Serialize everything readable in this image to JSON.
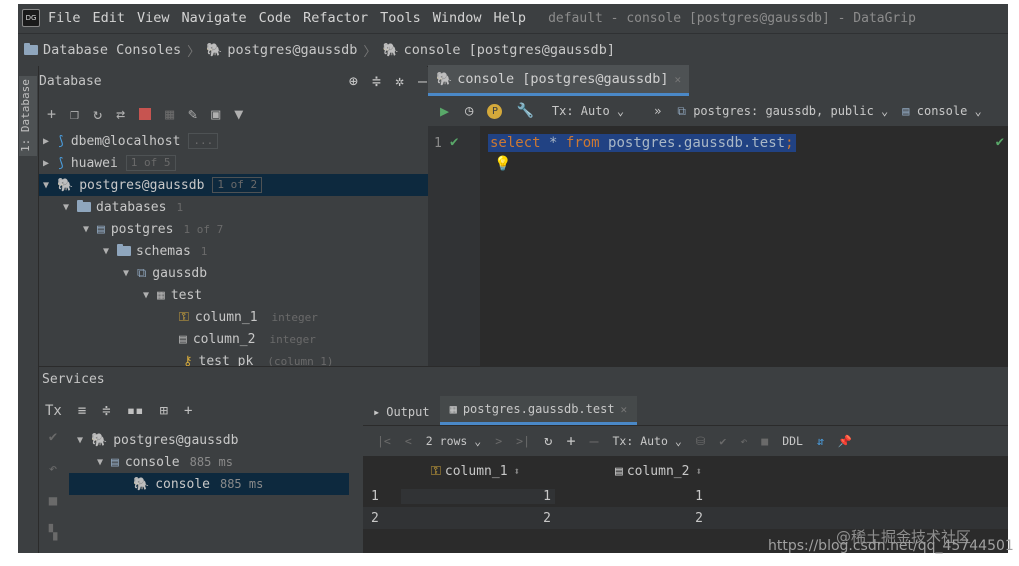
{
  "app": {
    "logo": "DG",
    "menu": [
      "File",
      "Edit",
      "View",
      "Navigate",
      "Code",
      "Refactor",
      "Tools",
      "Window",
      "Help"
    ],
    "window_title": "default - console [postgres@gaussdb] - DataGrip"
  },
  "breadcrumb": [
    "Database Consoles",
    "postgres@gaussdb",
    "console [postgres@gaussdb]"
  ],
  "side_strip": {
    "label": "1: Database"
  },
  "database_panel": {
    "title": "Database",
    "tree": [
      {
        "label": "dbem@localhost",
        "badge": "..."
      },
      {
        "label": "huawei",
        "badge": "1 of 5"
      },
      {
        "label": "postgres@gaussdb",
        "badge": "1 of 2"
      },
      {
        "label": "databases",
        "badge": "1"
      },
      {
        "label": "postgres",
        "badge": "1 of 7"
      },
      {
        "label": "schemas",
        "badge": "1"
      },
      {
        "label": "gaussdb",
        "badge": ""
      },
      {
        "label": "test",
        "badge": ""
      },
      {
        "label": "column_1",
        "badge": "integer"
      },
      {
        "label": "column_2",
        "badge": "integer"
      },
      {
        "label": "test_pk",
        "badge": "(column_1)"
      }
    ]
  },
  "editor": {
    "tab_label": "console [postgres@gaussdb]",
    "tx_label": "Tx: Auto",
    "overflow": "»",
    "schema_selector": "postgres: gaussdb, public",
    "console_selector": "console",
    "line_number": "1",
    "code": {
      "kw_select": "select",
      "star": "*",
      "kw_from": "from",
      "target": "postgres.gaussdb.test",
      "semi": ";"
    }
  },
  "services": {
    "title": "Services",
    "tx_icon_label": "Tx",
    "tree": [
      {
        "label": "postgres@gaussdb",
        "time": ""
      },
      {
        "label": "console",
        "time": "885 ms"
      },
      {
        "label": "console",
        "time": "885 ms"
      }
    ]
  },
  "results": {
    "tabs": [
      "Output",
      "postgres.gaussdb.test"
    ],
    "rows_label": "2 rows",
    "tx_label": "Tx: Auto",
    "ddl_label": "DDL",
    "columns": [
      "column_1",
      "column_2"
    ],
    "rows": [
      {
        "num": "1",
        "c1": "1",
        "c2": "1"
      },
      {
        "num": "2",
        "c1": "2",
        "c2": "2"
      }
    ]
  },
  "watermark": {
    "line1": "@稀土掘金技术社区",
    "line2": "https://blog.csdn.net/qq_45744501"
  },
  "colors": {
    "background": "#3c3f41",
    "editor_bg": "#2b2b2b",
    "selection": "#0d293e",
    "keyword": "#cc7832",
    "run_green": "#59a869",
    "accent": "#4a88c7"
  }
}
